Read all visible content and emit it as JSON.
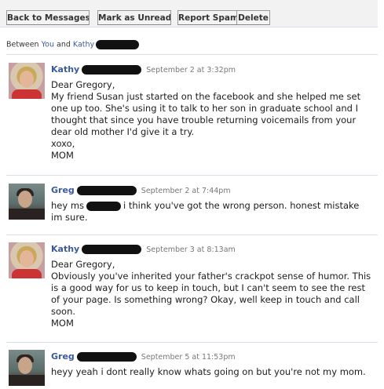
{
  "toolbar": {
    "back_label": "Back to Messages",
    "unread_label": "Mark as Unread",
    "spam_label": "Report Spam",
    "delete_label": "Delete"
  },
  "between": {
    "prefix": "Between",
    "you": "You",
    "and": "and",
    "other": "Kathy"
  },
  "messages": [
    {
      "author": "Kathy",
      "date": "September 2 at 3:32pm",
      "lines": [
        "Dear Gregory,",
        "My friend Susan just started on the facebook and she helped me set one up too. She's using it to talk to her son in graduate school and I thought that since you have trouble returning voicemails from your dear old mother I'd give it a try.",
        "xoxo,",
        "MOM"
      ]
    },
    {
      "author": "Greg",
      "date": "September 2 at 7:44pm",
      "text_before": "hey ms",
      "text_after": "i think you've got the wrong person. honest mistake im sure."
    },
    {
      "author": "Kathy",
      "date": "September 3 at 8:13am",
      "lines": [
        "Dear Gregory,",
        "Obviously you've inherited your father's crackpot sense of humor. This is a good way for us to keep in touch, but I can't seem to see the rest of your page. Is something wrong? Okay, well keep in touch and call soon.",
        "MOM"
      ]
    },
    {
      "author": "Greg",
      "date": "September 5 at 11:53pm",
      "text": "heyy yeah i dont really know whats going on but you're not my mom."
    }
  ],
  "colors": {
    "link": "#3b5998",
    "border": "#d8dfea",
    "toolbar_bg": "#f2f2f2"
  }
}
